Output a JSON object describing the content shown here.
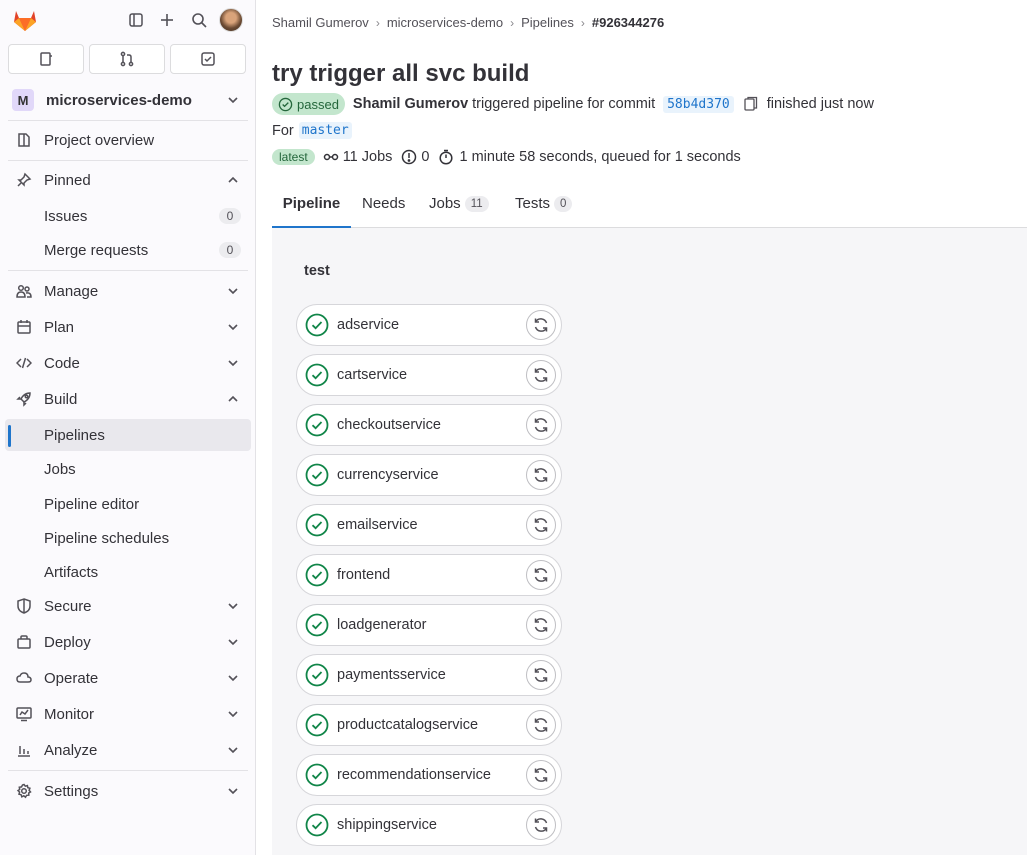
{
  "breadcrumb": [
    "Shamil Gumerov",
    "microservices-demo",
    "Pipelines",
    "#926344276"
  ],
  "project": {
    "badge": "M",
    "name": "microservices-demo"
  },
  "nav": {
    "overview": "Project overview",
    "pinned": "Pinned",
    "issues": "Issues",
    "issues_count": "0",
    "mrs": "Merge requests",
    "mrs_count": "0",
    "manage": "Manage",
    "plan": "Plan",
    "code": "Code",
    "build": "Build",
    "pipelines": "Pipelines",
    "jobs": "Jobs",
    "editor": "Pipeline editor",
    "schedules": "Pipeline schedules",
    "artifacts": "Artifacts",
    "secure": "Secure",
    "deploy": "Deploy",
    "operate": "Operate",
    "monitor": "Monitor",
    "analyze": "Analyze",
    "settings": "Settings"
  },
  "pipeline": {
    "title": "try trigger all svc build",
    "status": "passed",
    "author": "Shamil Gumerov",
    "triggered_text": "triggered pipeline for commit",
    "sha": "58b4d370",
    "finished": "finished just now",
    "for_label": "For",
    "ref": "master",
    "latest": "latest",
    "jobs_text": "11 Jobs",
    "warnings": "0",
    "duration": "1 minute 58 seconds, queued for 1 seconds"
  },
  "tabs": {
    "pipeline": "Pipeline",
    "needs": "Needs",
    "jobs": "Jobs",
    "jobs_count": "11",
    "tests": "Tests",
    "tests_count": "0"
  },
  "stage": {
    "name": "test",
    "jobs": [
      "adservice",
      "cartservice",
      "checkoutservice",
      "currencyservice",
      "emailservice",
      "frontend",
      "loadgenerator",
      "paymentsservice",
      "productcatalogservice",
      "recommendationservice",
      "shippingservice"
    ]
  },
  "colors": {
    "success": "#108548",
    "accent": "#1f75cb"
  }
}
